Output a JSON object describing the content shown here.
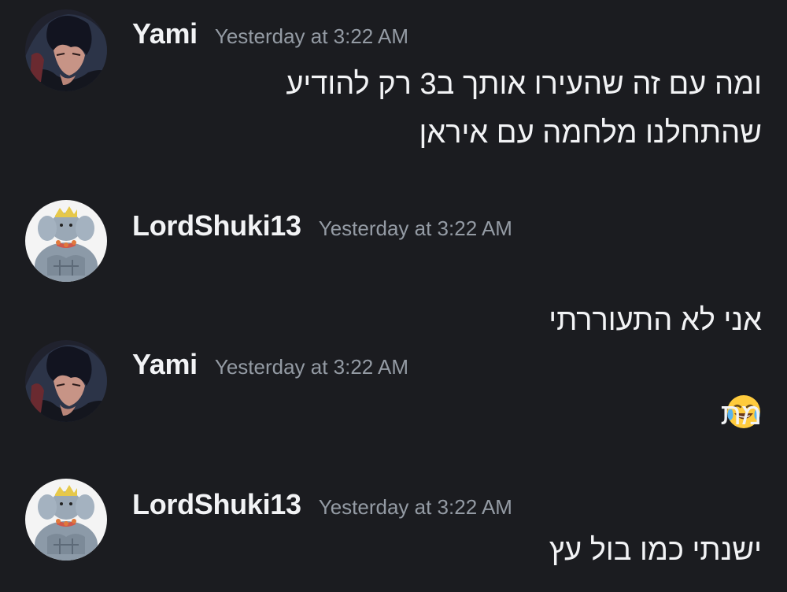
{
  "messages": [
    {
      "author": "Yami",
      "avatar_icon": "yami-avatar-icon",
      "timestamp": "Yesterday at 3:22 AM",
      "text": "ומה עם זה שהעירו אותך ב3 רק להודיע\nשהתחלנו מלחמה עם איראן"
    },
    {
      "author": "LordShuki13",
      "avatar_icon": "lordshuki-avatar-icon",
      "timestamp": "Yesterday at 3:22 AM",
      "text": "אני לא התעוררתי",
      "emoji": "joy-emoji-icon"
    },
    {
      "author": "Yami",
      "avatar_icon": "yami-avatar-icon",
      "timestamp": "Yesterday at 3:22 AM",
      "text": "מת"
    },
    {
      "author": "LordShuki13",
      "avatar_icon": "lordshuki-avatar-icon",
      "timestamp": "Yesterday at 3:22 AM",
      "text": "ישנתי כמו בול עץ"
    }
  ],
  "colors": {
    "background": "#1b1c20",
    "username": "#f2f3f5",
    "timestamp": "#949ba4",
    "message_text": "#f2f3f5"
  }
}
